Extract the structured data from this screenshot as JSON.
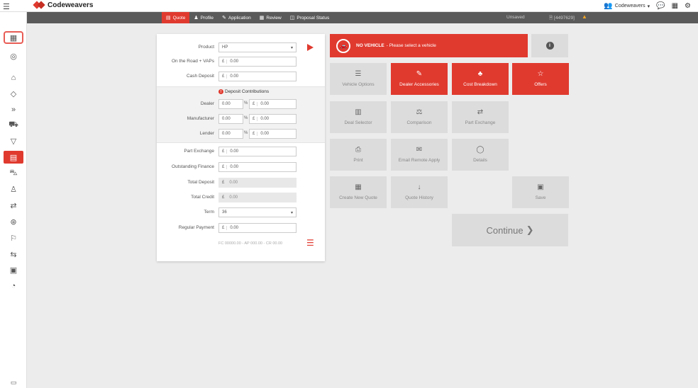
{
  "app": {
    "brand": "Codeweavers"
  },
  "topbar": {
    "user_label": "Codeweavers",
    "user_caret": "▾",
    "user_icon": "users-icon",
    "chat_icon": "chat-icon",
    "grid_icon": "grid-icon",
    "settings_icon": "gear-icon"
  },
  "subnav": {
    "tabs": [
      {
        "label": "Quote",
        "icon": "▤",
        "active": true
      },
      {
        "label": "Profile",
        "icon": "♟",
        "active": false
      },
      {
        "label": "Application",
        "icon": "✎",
        "active": false
      },
      {
        "label": "Review",
        "icon": "▦",
        "active": false
      },
      {
        "label": "Proposal Status",
        "icon": "◫",
        "active": false
      }
    ],
    "status": "Unsaved",
    "quote_id": "[4497629]",
    "warning_glyph": "▲"
  },
  "sidebar": {
    "icons": [
      "▦",
      "◎",
      "⌂",
      "◇",
      "»",
      "⛟",
      "▽",
      "▤",
      "⛍",
      "♙",
      "⇄",
      "⊛",
      "⚐",
      "⇆",
      "▣",
      "◔"
    ],
    "bottom_icon": "▭"
  },
  "form": {
    "product": {
      "label": "Product",
      "value": "HP",
      "caret": "▾"
    },
    "on_the_road": {
      "label": "On the Road + VAPs",
      "currency": "£",
      "value": "0.00"
    },
    "cash_deposit": {
      "label": "Cash Deposit",
      "currency": "£",
      "value": "0.00"
    },
    "contrib_title": "Deposit Contributions",
    "contrib_icon": "!",
    "contributions": [
      {
        "label": "Dealer",
        "pct": "0.00",
        "pct_sign": "%",
        "currency": "£",
        "amount": "0.00"
      },
      {
        "label": "Manufacturer",
        "pct": "0.00",
        "pct_sign": "%",
        "currency": "£",
        "amount": "0.00"
      },
      {
        "label": "Lender",
        "pct": "0.00",
        "pct_sign": "%",
        "currency": "£",
        "amount": "0.00"
      }
    ],
    "part_exchange": {
      "label": "Part Exchange",
      "currency": "£",
      "value": "0.00"
    },
    "outstanding_finance": {
      "label": "Outstanding Finance",
      "currency": "£",
      "value": "0.00"
    },
    "total_deposit": {
      "label": "Total Deposit",
      "currency": "£",
      "value": "0.00"
    },
    "total_credit": {
      "label": "Total Credit",
      "currency": "£",
      "value": "0.00"
    },
    "term": {
      "label": "Term",
      "value": "36",
      "caret": "▾"
    },
    "regular_payment": {
      "label": "Regular Payment",
      "currency": "£",
      "value": "0.00"
    },
    "summary": "FC 00000.00 - AP 000.00 - CR 00.00",
    "menu_glyph": "☰"
  },
  "vehicle_banner": {
    "bold": "NO VEHICLE",
    "text": "- Please select a vehicle",
    "icon": "🚗",
    "info": "i"
  },
  "tiles": {
    "vehicle_options": {
      "label": "Vehicle Options",
      "icon": "☰"
    },
    "dealer_accessories": {
      "label": "Dealer Accessories",
      "icon": "✎"
    },
    "cost_breakdown": {
      "label": "Cost Breakdown",
      "icon": "♣"
    },
    "offers": {
      "label": "Offers",
      "icon": "☆"
    },
    "deal_selector": {
      "label": "Deal Selector",
      "icon": "▥"
    },
    "comparison": {
      "label": "Comparison",
      "icon": "⚖"
    },
    "part_exchange": {
      "label": "Part Exchange",
      "icon": "⇄"
    },
    "print": {
      "label": "Print",
      "icon": "⎙"
    },
    "email_remote": {
      "label": "Email Remote Apply",
      "icon": "✉"
    },
    "details": {
      "label": "Details",
      "icon": "◯"
    },
    "create_new_quote": {
      "label": "Create New Quote",
      "icon": "▦"
    },
    "quote_history": {
      "label": "Quote History",
      "icon": "↓"
    },
    "save": {
      "label": "Save",
      "icon": "▣"
    }
  },
  "continue": {
    "label": "Continue",
    "arrow": "❯"
  },
  "colors": {
    "accent": "#e03a2f",
    "subnav": "#5a5a5a",
    "tile": "#dcdcdc",
    "page": "#ececec"
  }
}
